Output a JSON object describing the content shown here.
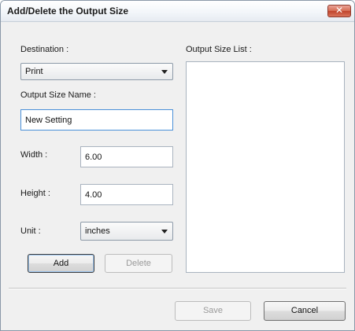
{
  "window": {
    "title": "Add/Delete the Output Size",
    "close_label": "✕"
  },
  "form": {
    "destination_label": "Destination :",
    "destination_value": "Print",
    "output_size_name_label": "Output Size Name :",
    "output_size_name_value": "New Setting",
    "width_label": "Width :",
    "width_value": "6.00",
    "height_label": "Height :",
    "height_value": "4.00",
    "unit_label": "Unit :",
    "unit_value": "inches"
  },
  "list": {
    "label": "Output Size List :",
    "items": []
  },
  "buttons": {
    "add": "Add",
    "delete": "Delete",
    "save": "Save",
    "cancel": "Cancel"
  },
  "colors": {
    "close_button": "#c0432c",
    "window_bg": "#f0f0f0",
    "focus_border": "#4a90d9"
  }
}
